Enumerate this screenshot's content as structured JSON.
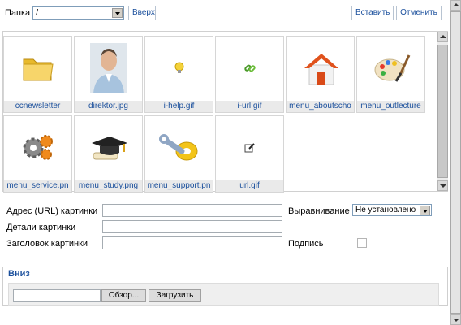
{
  "toolbar": {
    "folder_label": "Папка",
    "folder_value": "/",
    "up_label": "Вверх",
    "insert_label": "Вставить",
    "cancel_label": "Отменить"
  },
  "files": [
    {
      "name": "ccnewsletter",
      "icon": "folder-icon"
    },
    {
      "name": "direktor.jpg",
      "icon": "portrait-photo"
    },
    {
      "name": "i-help.gif",
      "icon": "lightbulb-icon"
    },
    {
      "name": "i-url.gif",
      "icon": "link-icon"
    },
    {
      "name": "menu_aboutscho",
      "icon": "house-icon"
    },
    {
      "name": "menu_outlecture",
      "icon": "palette-icon"
    },
    {
      "name": "menu_service.pn",
      "icon": "gears-icon"
    },
    {
      "name": "menu_study.png",
      "icon": "graduation-cap-icon"
    },
    {
      "name": "menu_support.pn",
      "icon": "wrench-tape-icon"
    },
    {
      "name": "url.gif",
      "icon": "edit-link-icon"
    }
  ],
  "form": {
    "url_label": "Адрес (URL) картинки",
    "details_label": "Детали картинки",
    "title_label": "Заголовок картинки",
    "align_label": "Выравнивание",
    "align_value": "Не установлено",
    "caption_label": "Подпись"
  },
  "upload": {
    "legend": "Вниз",
    "browse_label": "Обзор...",
    "upload_label": "Загрузить"
  },
  "colors": {
    "link_blue": "#1a4f9c",
    "caption_bg": "#eaeaea"
  }
}
